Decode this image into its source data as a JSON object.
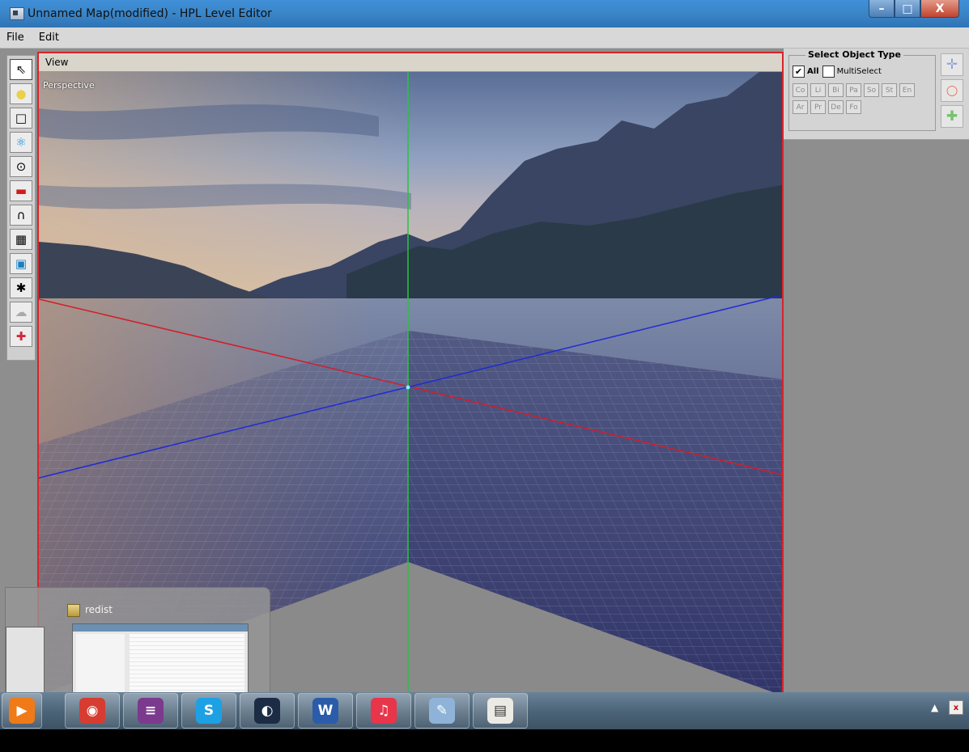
{
  "window": {
    "title": "Unnamed Map(modified) - HPL Level Editor",
    "minimize_label": "–",
    "maximize_label": "□",
    "close_label": "X"
  },
  "menu": {
    "items": [
      {
        "label": "File"
      },
      {
        "label": "Edit"
      }
    ]
  },
  "toolbar": {
    "tools": [
      {
        "name": "select-tool",
        "icon": "⇖",
        "icon_name": "cursor-arrow-icon",
        "active": true
      },
      {
        "name": "light-tool",
        "icon": "●",
        "icon_name": "light-bulb-icon",
        "color": "#e8d24a"
      },
      {
        "name": "billboard-tool",
        "icon": "□",
        "icon_name": "billboard-icon"
      },
      {
        "name": "particle-tool",
        "icon": "⚛",
        "icon_name": "particle-atom-icon",
        "color": "#1a8fd6"
      },
      {
        "name": "sound-tool",
        "icon": "⊙",
        "icon_name": "sound-icon"
      },
      {
        "name": "static-object-tool",
        "icon": "▬",
        "icon_name": "red-block-icon",
        "color": "#d01c1c"
      },
      {
        "name": "entity-tool",
        "icon": "∩",
        "icon_name": "arch-icon"
      },
      {
        "name": "area-tool",
        "icon": "▦",
        "icon_name": "cube-area-icon"
      },
      {
        "name": "primitive-tool",
        "icon": "▣",
        "icon_name": "primitive-icon",
        "color": "#1a7fc0"
      },
      {
        "name": "decal-tool",
        "icon": "✱",
        "icon_name": "decal-star-icon"
      },
      {
        "name": "fog-area-tool",
        "icon": "☁",
        "icon_name": "fog-area-icon",
        "color": "#aaaaaa"
      },
      {
        "name": "combine-tool",
        "icon": "✚",
        "icon_name": "combine-icon",
        "color": "#d02a3a"
      }
    ]
  },
  "view": {
    "header_label": "View",
    "camera_mode": "Perspective"
  },
  "select_object_type": {
    "title": "Select Object Type",
    "all_label": "All",
    "all_checked": true,
    "multiselect_label": "MultiSelect",
    "multiselect_checked": false,
    "type_buttons_row1": [
      "Co",
      "Li",
      "Bi",
      "Pa",
      "So",
      "St",
      "En"
    ],
    "type_buttons_row2": [
      "Ar",
      "Pr",
      "De",
      "Fo"
    ]
  },
  "gizmos": [
    {
      "name": "translate-gizmo-button",
      "icon": "✛",
      "icon_name": "move-arrows-icon",
      "color": "#8fa0d6"
    },
    {
      "name": "rotate-gizmo-button",
      "icon": "○",
      "icon_name": "rotate-icon",
      "color": "#e57a5a"
    },
    {
      "name": "scale-gizmo-button",
      "icon": "✚",
      "icon_name": "scale-icon",
      "color": "#72c46a"
    }
  ],
  "preview": {
    "label": "redist"
  },
  "taskbar": {
    "apps": [
      {
        "name": "media-player",
        "icon": "▶",
        "icon_name": "media-player-icon",
        "color": "#f07a17"
      },
      {
        "name": "chrome",
        "icon": "◉",
        "icon_name": "chrome-icon",
        "color": "#d63c31"
      },
      {
        "name": "winrar",
        "icon": "≡",
        "icon_name": "winrar-icon",
        "color": "#7b3a8e"
      },
      {
        "name": "skype",
        "icon": "S",
        "icon_name": "skype-icon",
        "color": "#1da1e4"
      },
      {
        "name": "steam",
        "icon": "◐",
        "icon_name": "steam-icon",
        "color": "#1c2c44"
      },
      {
        "name": "word",
        "icon": "W",
        "icon_name": "word-icon",
        "color": "#2a5caa"
      },
      {
        "name": "itunes",
        "icon": "♫",
        "icon_name": "itunes-icon",
        "color": "#e8354a"
      },
      {
        "name": "paint",
        "icon": "✎",
        "icon_name": "paint-palette-icon",
        "color": "#8fb3d8"
      },
      {
        "name": "level-editor",
        "icon": "▤",
        "icon_name": "level-editor-icon",
        "color": "#eceae4"
      }
    ],
    "tray_arrow": "▲",
    "tray_flag": "x"
  }
}
